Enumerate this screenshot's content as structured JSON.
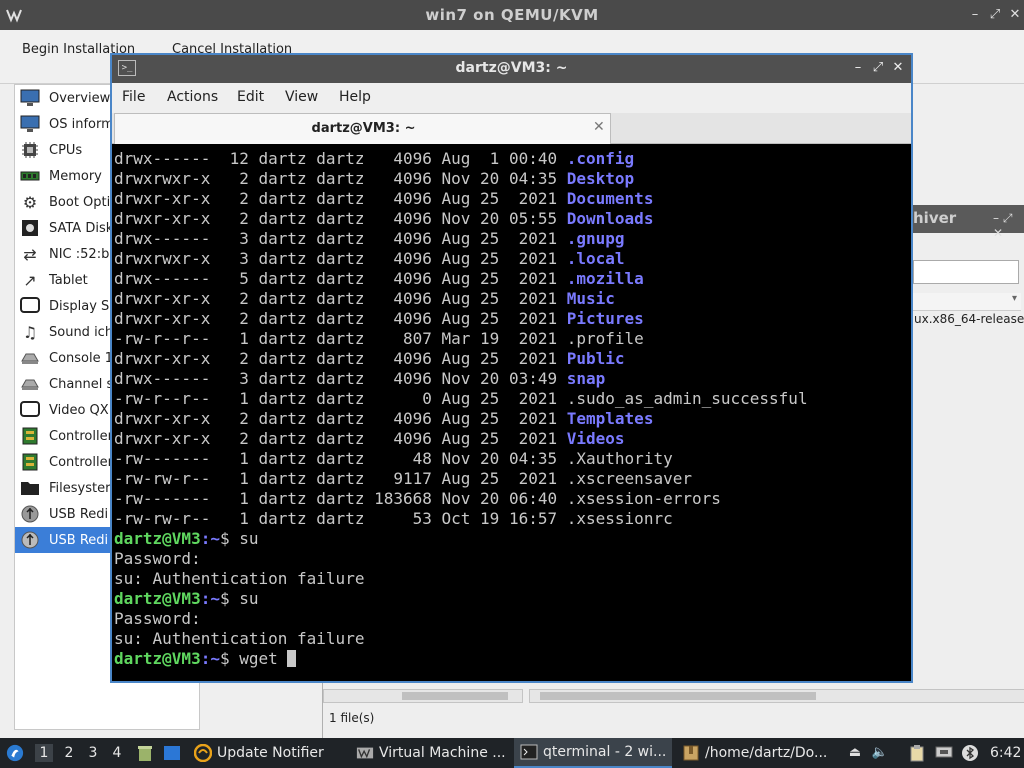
{
  "vm_window": {
    "title": "win7 on QEMU/KVM",
    "toolbar": {
      "begin_label": "Begin Installation",
      "cancel_label": "Cancel Installation"
    },
    "hardware_items": [
      {
        "label": "Overview",
        "icon": "monitor-icon"
      },
      {
        "label": "OS inform",
        "icon": "monitor-icon"
      },
      {
        "label": "CPUs",
        "icon": "cpu-icon"
      },
      {
        "label": "Memory",
        "icon": "memory-icon"
      },
      {
        "label": "Boot Opti",
        "icon": "gear-icon"
      },
      {
        "label": "SATA Disk",
        "icon": "disk-icon"
      },
      {
        "label": "NIC :52:b",
        "icon": "network-icon"
      },
      {
        "label": "Tablet",
        "icon": "tablet-icon"
      },
      {
        "label": "Display S",
        "icon": "display-icon"
      },
      {
        "label": "Sound ich",
        "icon": "sound-icon"
      },
      {
        "label": "Console 1",
        "icon": "console-icon"
      },
      {
        "label": "Channel s",
        "icon": "channel-icon"
      },
      {
        "label": "Video QX",
        "icon": "video-icon"
      },
      {
        "label": "Controller",
        "icon": "controller-icon"
      },
      {
        "label": "Controller",
        "icon": "controller-icon"
      },
      {
        "label": "Filesyster",
        "icon": "folder-icon"
      },
      {
        "label": "USB Redi",
        "icon": "usb-icon"
      },
      {
        "label": "USB Redi",
        "icon": "usb-icon",
        "selected": true
      }
    ]
  },
  "file_manager": {
    "title_fragment": "hiver",
    "file_fragment": "ux.x86_64-release",
    "status": "1 file(s)"
  },
  "terminal": {
    "window_title": "dartz@VM3: ~",
    "menu": [
      "File",
      "Actions",
      "Edit",
      "View",
      "Help"
    ],
    "tab_label": "dartz@VM3: ~",
    "listing": [
      {
        "perms": "drwx------",
        "links": "12",
        "owner": "dartz",
        "group": "dartz",
        "size": "4096",
        "month": "Aug",
        "day": "1",
        "time": "00:40",
        "name": ".config",
        "is_dir": true
      },
      {
        "perms": "drwxrwxr-x",
        "links": "2",
        "owner": "dartz",
        "group": "dartz",
        "size": "4096",
        "month": "Nov",
        "day": "20",
        "time": "04:35",
        "name": "Desktop",
        "is_dir": true
      },
      {
        "perms": "drwxr-xr-x",
        "links": "2",
        "owner": "dartz",
        "group": "dartz",
        "size": "4096",
        "month": "Aug",
        "day": "25",
        "time": "2021",
        "name": "Documents",
        "is_dir": true
      },
      {
        "perms": "drwxr-xr-x",
        "links": "2",
        "owner": "dartz",
        "group": "dartz",
        "size": "4096",
        "month": "Nov",
        "day": "20",
        "time": "05:55",
        "name": "Downloads",
        "is_dir": true
      },
      {
        "perms": "drwx------",
        "links": "3",
        "owner": "dartz",
        "group": "dartz",
        "size": "4096",
        "month": "Aug",
        "day": "25",
        "time": "2021",
        "name": ".gnupg",
        "is_dir": true
      },
      {
        "perms": "drwxrwxr-x",
        "links": "3",
        "owner": "dartz",
        "group": "dartz",
        "size": "4096",
        "month": "Aug",
        "day": "25",
        "time": "2021",
        "name": ".local",
        "is_dir": true
      },
      {
        "perms": "drwx------",
        "links": "5",
        "owner": "dartz",
        "group": "dartz",
        "size": "4096",
        "month": "Aug",
        "day": "25",
        "time": "2021",
        "name": ".mozilla",
        "is_dir": true
      },
      {
        "perms": "drwxr-xr-x",
        "links": "2",
        "owner": "dartz",
        "group": "dartz",
        "size": "4096",
        "month": "Aug",
        "day": "25",
        "time": "2021",
        "name": "Music",
        "is_dir": true
      },
      {
        "perms": "drwxr-xr-x",
        "links": "2",
        "owner": "dartz",
        "group": "dartz",
        "size": "4096",
        "month": "Aug",
        "day": "25",
        "time": "2021",
        "name": "Pictures",
        "is_dir": true
      },
      {
        "perms": "-rw-r--r--",
        "links": "1",
        "owner": "dartz",
        "group": "dartz",
        "size": "807",
        "month": "Mar",
        "day": "19",
        "time": "2021",
        "name": ".profile",
        "is_dir": false
      },
      {
        "perms": "drwxr-xr-x",
        "links": "2",
        "owner": "dartz",
        "group": "dartz",
        "size": "4096",
        "month": "Aug",
        "day": "25",
        "time": "2021",
        "name": "Public",
        "is_dir": true
      },
      {
        "perms": "drwx------",
        "links": "3",
        "owner": "dartz",
        "group": "dartz",
        "size": "4096",
        "month": "Nov",
        "day": "20",
        "time": "03:49",
        "name": "snap",
        "is_dir": true
      },
      {
        "perms": "-rw-r--r--",
        "links": "1",
        "owner": "dartz",
        "group": "dartz",
        "size": "0",
        "month": "Aug",
        "day": "25",
        "time": "2021",
        "name": ".sudo_as_admin_successful",
        "is_dir": false
      },
      {
        "perms": "drwxr-xr-x",
        "links": "2",
        "owner": "dartz",
        "group": "dartz",
        "size": "4096",
        "month": "Aug",
        "day": "25",
        "time": "2021",
        "name": "Templates",
        "is_dir": true
      },
      {
        "perms": "drwxr-xr-x",
        "links": "2",
        "owner": "dartz",
        "group": "dartz",
        "size": "4096",
        "month": "Aug",
        "day": "25",
        "time": "2021",
        "name": "Videos",
        "is_dir": true
      },
      {
        "perms": "-rw-------",
        "links": "1",
        "owner": "dartz",
        "group": "dartz",
        "size": "48",
        "month": "Nov",
        "day": "20",
        "time": "04:35",
        "name": ".Xauthority",
        "is_dir": false
      },
      {
        "perms": "-rw-rw-r--",
        "links": "1",
        "owner": "dartz",
        "group": "dartz",
        "size": "9117",
        "month": "Aug",
        "day": "25",
        "time": "2021",
        "name": ".xscreensaver",
        "is_dir": false
      },
      {
        "perms": "-rw-------",
        "links": "1",
        "owner": "dartz",
        "group": "dartz",
        "size": "183668",
        "month": "Nov",
        "day": "20",
        "time": "06:40",
        "name": ".xsession-errors",
        "is_dir": false
      },
      {
        "perms": "-rw-rw-r--",
        "links": "1",
        "owner": "dartz",
        "group": "dartz",
        "size": "53",
        "month": "Oct",
        "day": "19",
        "time": "16:57",
        "name": ".xsessionrc",
        "is_dir": false
      }
    ],
    "prompt_user": "dartz@VM3",
    "prompt_path": ":~",
    "prompt_symbol": "$",
    "session": [
      {
        "type": "prompt",
        "command": " su"
      },
      {
        "type": "output",
        "text": "Password:"
      },
      {
        "type": "output",
        "text": "su: Authentication failure"
      },
      {
        "type": "prompt",
        "command": " su"
      },
      {
        "type": "output",
        "text": "Password:"
      },
      {
        "type": "output",
        "text": "su: Authentication failure"
      },
      {
        "type": "prompt",
        "command": " wget ",
        "cursor": true
      }
    ]
  },
  "taskbar": {
    "workspaces": [
      "1",
      "2",
      "3",
      "4"
    ],
    "active_workspace": "1",
    "tasks": [
      {
        "label": "Update Notifier",
        "icon": "update-notifier-icon"
      },
      {
        "label": "Virtual Machine ...",
        "icon": "virt-manager-icon"
      },
      {
        "label": "qterminal - 2 wi...",
        "icon": "terminal-icon"
      },
      {
        "label": "/home/dartz/Do...",
        "icon": "archive-icon"
      }
    ],
    "clock": "6:42"
  },
  "colors": {
    "terminal_dir": "#7a7aff",
    "terminal_prompt_user": "#5fd75f",
    "terminal_text": "#c8c8c8",
    "selection": "#3b7ed8",
    "active_border": "#4a86c8"
  }
}
